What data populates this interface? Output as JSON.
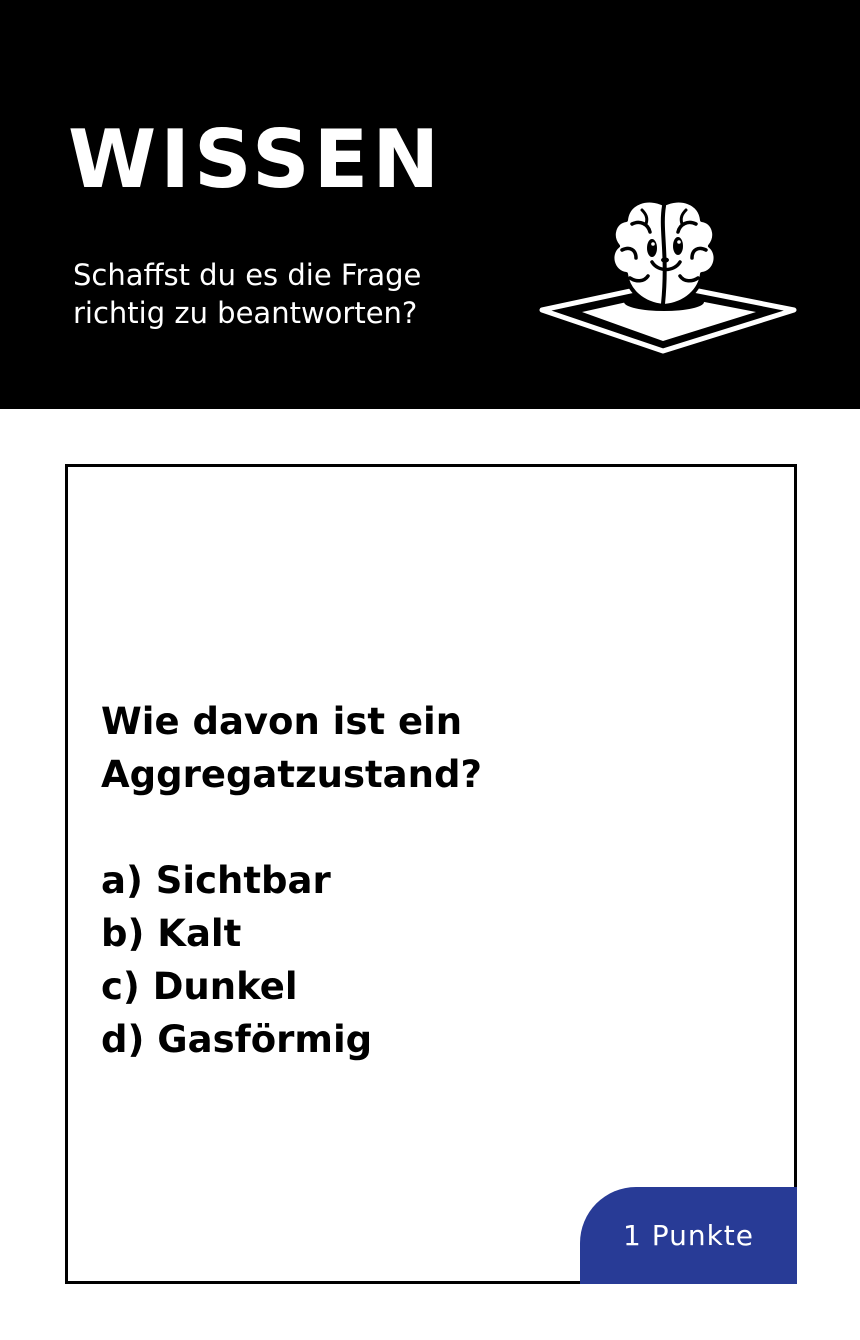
{
  "header": {
    "title": "WISSEN",
    "subtitle": "Schaffst du es die Frage richtig zu beantworten?",
    "emblem_icon": "brain-on-tile-icon"
  },
  "card": {
    "question": "Wie davon ist ein Aggregatzustand?",
    "answers": [
      "a) Sichtbar",
      "b) Kalt",
      "c) Dunkel",
      "d) Gasförmig"
    ],
    "points_label": "1 Punkte"
  },
  "colors": {
    "header_background": "#000000",
    "header_text": "#ffffff",
    "card_border": "#000000",
    "badge_background": "#283b96",
    "badge_text": "#ffffff"
  }
}
